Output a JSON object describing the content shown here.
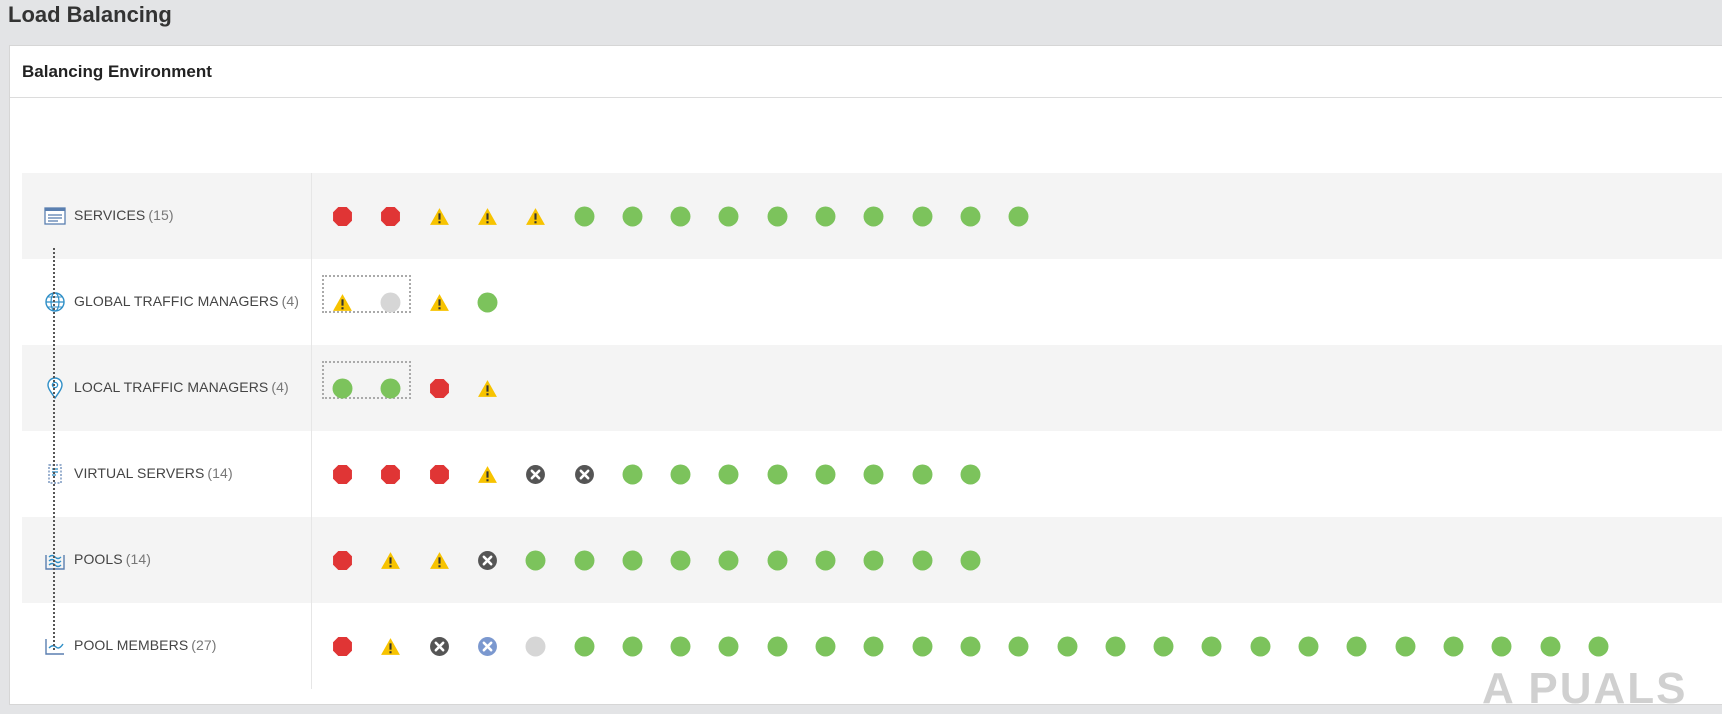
{
  "page": {
    "title": "Load Balancing"
  },
  "panel": {
    "title": "Balancing Environment"
  },
  "colors": {
    "ok": "#7cc35c",
    "critical": "#e03535",
    "warning": "#f7c300",
    "down": "#555555",
    "unknown": "#d6d6d6",
    "unmanaged": "#7b98cf"
  },
  "rows": [
    {
      "icon": "services-icon",
      "label": "SERVICES",
      "count": "(15)",
      "groups": [],
      "statuses": [
        "critical",
        "critical",
        "warning",
        "warning",
        "warning",
        "ok",
        "ok",
        "ok",
        "ok",
        "ok",
        "ok",
        "ok",
        "ok",
        "ok",
        "ok"
      ]
    },
    {
      "icon": "globe-icon",
      "label": "GLOBAL TRAFFIC MANAGERS",
      "count": "(4)",
      "groups": [
        [
          0,
          1
        ]
      ],
      "statuses": [
        "warning",
        "unknown",
        "warning",
        "ok"
      ]
    },
    {
      "icon": "location-pin-icon",
      "label": "LOCAL TRAFFIC MANAGERS",
      "count": "(4)",
      "groups": [
        [
          0,
          1
        ]
      ],
      "statuses": [
        "ok",
        "ok",
        "critical",
        "warning"
      ]
    },
    {
      "icon": "virtual-server-icon",
      "label": "VIRTUAL SERVERS",
      "count": "(14)",
      "groups": [],
      "statuses": [
        "critical",
        "critical",
        "critical",
        "warning",
        "down",
        "down",
        "ok",
        "ok",
        "ok",
        "ok",
        "ok",
        "ok",
        "ok",
        "ok"
      ]
    },
    {
      "icon": "pool-icon",
      "label": "POOLS",
      "count": "(14)",
      "groups": [],
      "statuses": [
        "critical",
        "warning",
        "warning",
        "down",
        "ok",
        "ok",
        "ok",
        "ok",
        "ok",
        "ok",
        "ok",
        "ok",
        "ok",
        "ok"
      ]
    },
    {
      "icon": "pool-members-icon",
      "label": "POOL MEMBERS",
      "count": "(27)",
      "groups": [],
      "statuses": [
        "critical",
        "warning",
        "down",
        "unmanaged",
        "unknown",
        "ok",
        "ok",
        "ok",
        "ok",
        "ok",
        "ok",
        "ok",
        "ok",
        "ok",
        "ok",
        "ok",
        "ok",
        "ok",
        "ok",
        "ok",
        "ok",
        "ok",
        "ok",
        "ok",
        "ok",
        "ok",
        "ok"
      ]
    }
  ],
  "watermark": "A PUALS"
}
